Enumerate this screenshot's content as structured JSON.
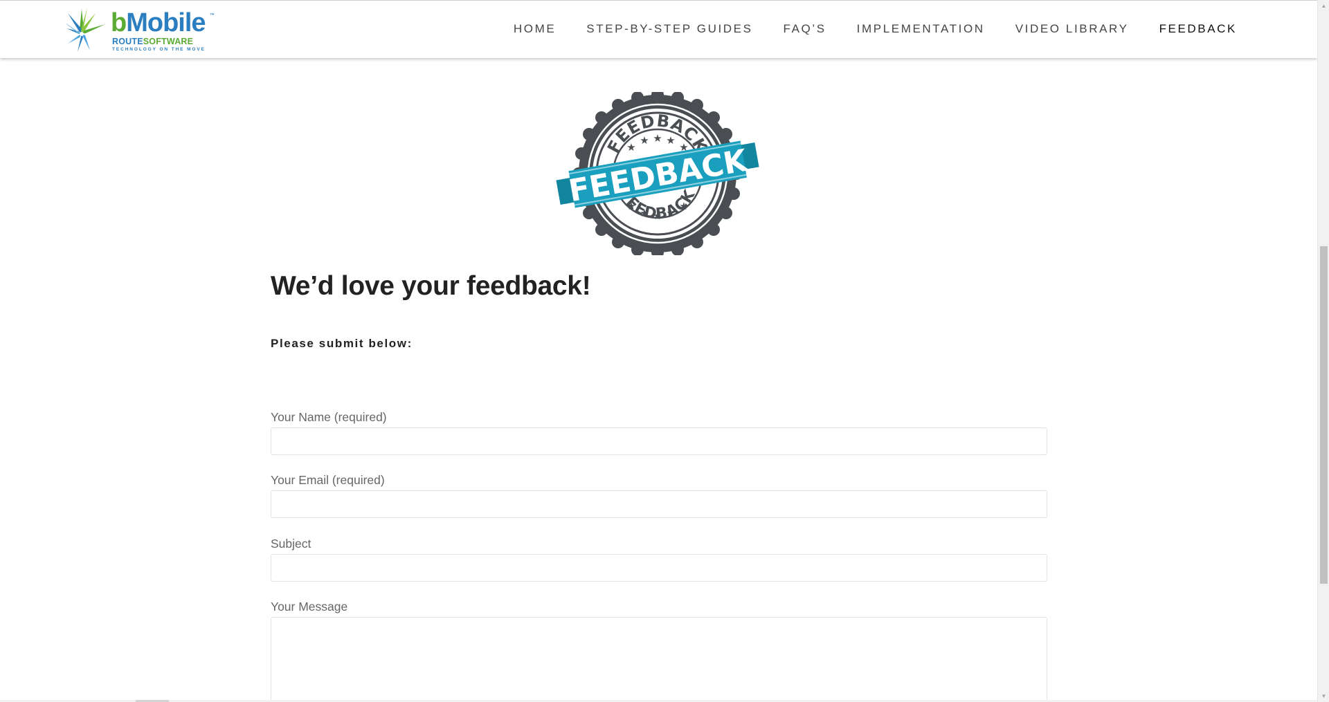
{
  "brand": {
    "logo": {
      "word_b": "b",
      "word_rest": "Mobile",
      "trademark": "™",
      "route": "ROUTE",
      "software": "SOFTWARE",
      "tagline": "TECHNOLOGY ON THE MOVE"
    },
    "colors": {
      "green": "#5aaa33",
      "blue": "#2b7fc0",
      "badge_teal": "#1aa0be",
      "badge_gray": "#4a4d52"
    }
  },
  "nav": {
    "items": [
      {
        "label": "HOME",
        "active": false
      },
      {
        "label": "STEP-BY-STEP GUIDES",
        "active": false
      },
      {
        "label": "FAQ’S",
        "active": false
      },
      {
        "label": "IMPLEMENTATION",
        "active": false
      },
      {
        "label": "VIDEO LIBRARY",
        "active": false
      },
      {
        "label": "FEEDBACK",
        "active": true
      }
    ]
  },
  "badge": {
    "banner_text": "FEEDBACK",
    "top_ring_text": "FEEDBACK",
    "bottom_ring_text": "FEEDBACK"
  },
  "main": {
    "title": "We’d love your feedback!",
    "intro": "Please submit below:"
  },
  "form": {
    "name_label": "Your Name (required)",
    "name_value": "",
    "email_label": "Your Email (required)",
    "email_value": "",
    "subject_label": "Subject",
    "subject_value": "",
    "message_label": "Your Message",
    "message_value": ""
  },
  "icons": {
    "scroll_up": "chevron-up-icon",
    "scroll_down": "chevron-down-icon",
    "logo_burst": "starburst-icon"
  }
}
